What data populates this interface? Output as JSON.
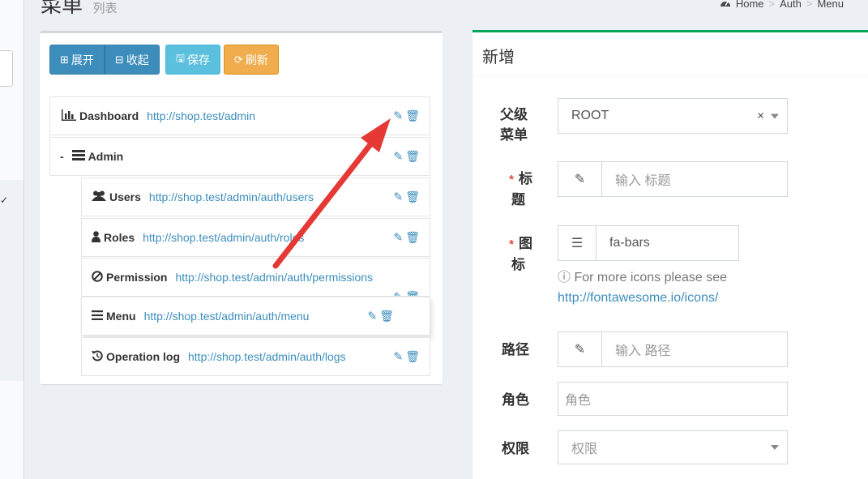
{
  "header": {
    "title": "菜单",
    "subtitle": "列表"
  },
  "breadcrumb": {
    "home_icon": "dashboard-icon",
    "items": [
      "Home",
      "Auth",
      "Menu"
    ]
  },
  "toolbar": {
    "expand_label": "展开",
    "collapse_label": "收起",
    "save_label": "保存",
    "refresh_label": "刷新"
  },
  "menu_tree": [
    {
      "icon": "bar-chart-icon",
      "glyph": "📊",
      "title": "Dashboard",
      "url": "http://shop.test/admin",
      "level": 0
    },
    {
      "icon": "tasks-icon",
      "glyph": "☰",
      "title": "Admin",
      "url": "",
      "level": 0,
      "collapse": "-"
    },
    {
      "icon": "users-icon",
      "glyph": "👥",
      "title": "Users",
      "url": "http://shop.test/admin/auth/users",
      "level": 1
    },
    {
      "icon": "user-icon",
      "glyph": "👤",
      "title": "Roles",
      "url": "http://shop.test/admin/auth/roles",
      "level": 1
    },
    {
      "icon": "ban-icon",
      "glyph": "⊘",
      "title": "Permission",
      "url": "http://shop.test/admin/auth/permissions",
      "level": 1
    },
    {
      "icon": "bars-icon",
      "glyph": "≡",
      "title": "Menu",
      "url": "http://shop.test/admin/auth/menu",
      "level": 1
    },
    {
      "icon": "history-icon",
      "glyph": "↺",
      "title": "Operation log",
      "url": "http://shop.test/admin/auth/logs",
      "level": 1
    }
  ],
  "form": {
    "title": "新增",
    "parent_label_1": "父级",
    "parent_label_2": "菜单",
    "parent_value": "ROOT",
    "clear_glyph": "×",
    "title_label_1": "标",
    "title_label_2": "题",
    "title_placeholder": "输入 标题",
    "icon_label_1": "图",
    "icon_label_2": "标",
    "icon_value": "fa-bars",
    "icon_help": "For more icons please see",
    "icon_help_link": "http://fontawesome.io/icons/",
    "path_label": "路径",
    "path_placeholder": "输入 路径",
    "role_label": "角色",
    "role_placeholder": "角色",
    "permission_label": "权限",
    "permission_placeholder": "权限"
  },
  "colors": {
    "primary": "#3c8dbc",
    "info": "#5bc0de",
    "warning": "#f0ad4e",
    "success": "#00a65a",
    "danger_arrow": "#e53935"
  }
}
